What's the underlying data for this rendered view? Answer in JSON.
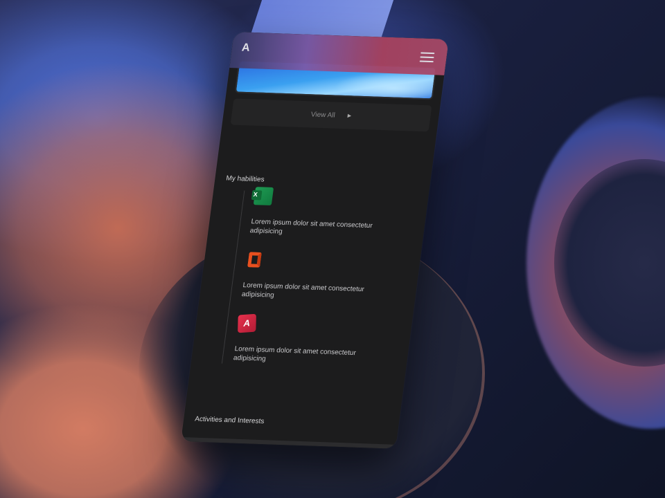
{
  "header": {
    "logo": "A",
    "menu_icon": "hamburger-menu-icon"
  },
  "gallery": {
    "view_all_label": "View All",
    "view_all_icon": "caret-right-icon"
  },
  "abilities": {
    "title": "My habilities",
    "items": [
      {
        "icon": "excel-icon",
        "text": "Lorem ipsum dolor sit amet consectetur adipisicing"
      },
      {
        "icon": "office-icon",
        "text": "Lorem ipsum dolor sit amet consectetur adipisicing"
      },
      {
        "icon": "access-icon",
        "text": "Lorem ipsum dolor sit amet consectetur adipisicing"
      }
    ]
  },
  "activities": {
    "title": "Activities and Interests"
  },
  "colors": {
    "app_bg": "#1c1c1d",
    "card_bg": "#242425",
    "text": "#c9c9cc",
    "excel_green": "#1f9a53",
    "office_orange": "#e8501f",
    "access_red": "#e8314d"
  }
}
